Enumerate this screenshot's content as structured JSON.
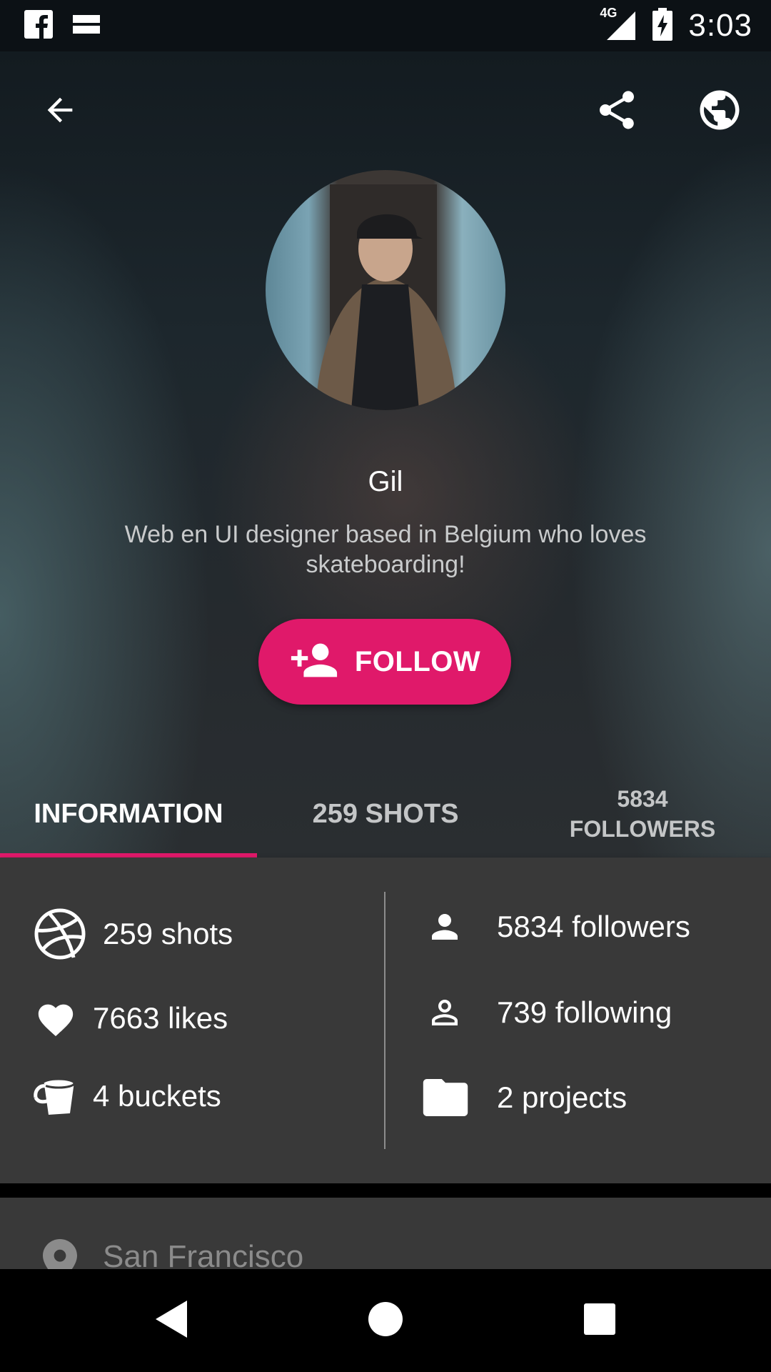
{
  "status_bar": {
    "time": "3:03",
    "network": "4G",
    "icons": [
      "facebook-icon",
      "notification-icon",
      "signal-icon",
      "battery-charging-icon"
    ]
  },
  "app_bar": {
    "icons": [
      "arrow-back-icon",
      "share-icon",
      "globe-icon"
    ]
  },
  "profile": {
    "name": "Gil",
    "bio": "Web en UI designer based in Belgium who loves skateboarding!",
    "follow_label": "FOLLOW",
    "accent_color": "#e0196a"
  },
  "tabs": [
    {
      "label": "INFORMATION",
      "active": true
    },
    {
      "label": "259 SHOTS",
      "active": false
    },
    {
      "label_line1": "5834",
      "label_line2": "FOLLOWERS",
      "active": false
    }
  ],
  "stats": {
    "left": [
      {
        "icon": "dribbble-ball-icon",
        "label": "259 shots"
      },
      {
        "icon": "heart-icon",
        "label": "7663 likes"
      },
      {
        "icon": "bucket-icon",
        "label": "4 buckets"
      }
    ],
    "right": [
      {
        "icon": "person-icon",
        "label": "5834 followers"
      },
      {
        "icon": "person-outline-icon",
        "label": "739 following"
      },
      {
        "icon": "folder-icon",
        "label": "2 projects"
      }
    ]
  },
  "location": {
    "icon": "location-pin-icon",
    "label": "San Francisco"
  },
  "nav_bar": {
    "icons": [
      "nav-back-icon",
      "nav-home-icon",
      "nav-recents-icon"
    ]
  }
}
